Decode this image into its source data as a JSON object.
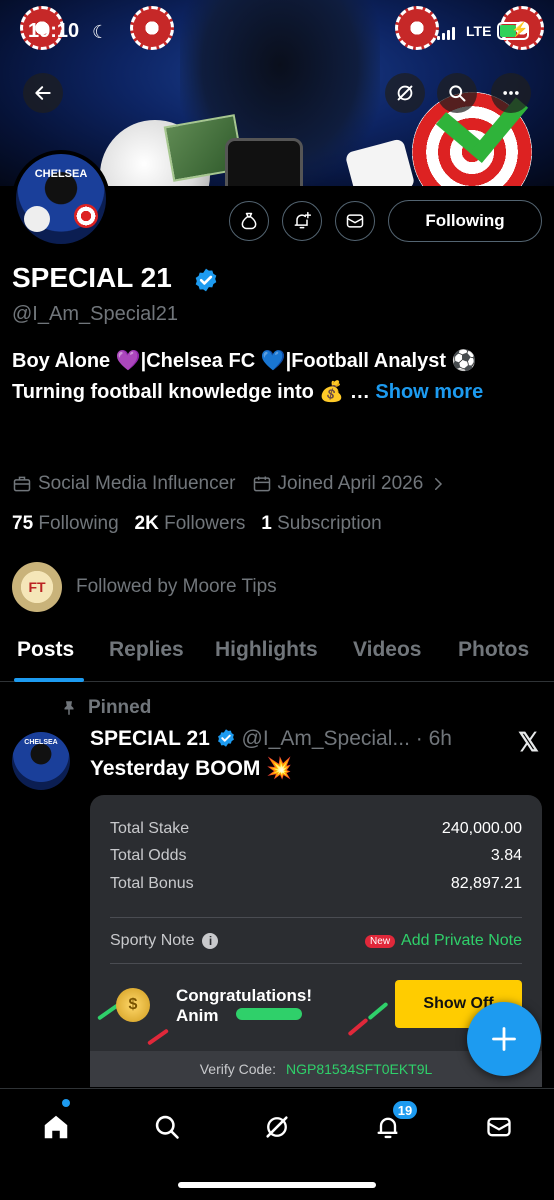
{
  "status_bar": {
    "time": "19:10",
    "network": "LTE"
  },
  "profile": {
    "avatar_label": "CHELSEA",
    "name": "SPECIAL 21",
    "handle": "@I_Am_Special21",
    "bio_line1": "Boy Alone 💜|Chelsea FC 💙|Football Analyst ⚽",
    "bio_line2": "Turning football knowledge into 💰 …",
    "show_more": "Show more",
    "category": "Social Media Influencer",
    "joined": "Joined April 2026",
    "following_count": "75",
    "following_label": "Following",
    "followers_count": "2K",
    "followers_label": "Followers",
    "subscription_count": "1",
    "subscription_label": "Subscription",
    "followed_by": "Followed by Moore Tips",
    "follow_button": "Following"
  },
  "tabs": [
    "Posts",
    "Replies",
    "Highlights",
    "Videos",
    "Photos"
  ],
  "active_tab": "Posts",
  "post": {
    "pinned_label": "Pinned",
    "author": "SPECIAL 21",
    "handle_time": "@I_Am_Special... · 6h",
    "text": "Yesterday BOOM 💥",
    "ticket": {
      "total_stake_label": "Total Stake",
      "total_stake": "240,000.00",
      "total_odds_label": "Total Odds",
      "total_odds": "3.84",
      "total_bonus_label": "Total Bonus",
      "total_bonus": "82,897.21",
      "sporty_note": "Sporty Note",
      "new_badge": "New",
      "private_note": "Add Private Note",
      "congrats_line1": "Congratulations!",
      "congrats_line2": "Anim",
      "show_off": "Show Off",
      "verify_label": "Verify Code:",
      "verify_code": "NGP81534SFT0EKT9L"
    }
  },
  "nav": {
    "notification_count": "19"
  },
  "colors": {
    "accent": "#1d9bf0",
    "muted": "#71767b",
    "background": "#000000",
    "green": "#2fd06a"
  },
  "icons": [
    "back-arrow-icon",
    "grok-icon",
    "search-icon",
    "more-icon",
    "tip-bag-icon",
    "bell-plus-icon",
    "mail-icon",
    "verified-badge-icon",
    "briefcase-icon",
    "calendar-icon",
    "chevron-right-icon",
    "pin-icon",
    "x-logo-icon",
    "home-icon",
    "compose-plus-icon"
  ]
}
